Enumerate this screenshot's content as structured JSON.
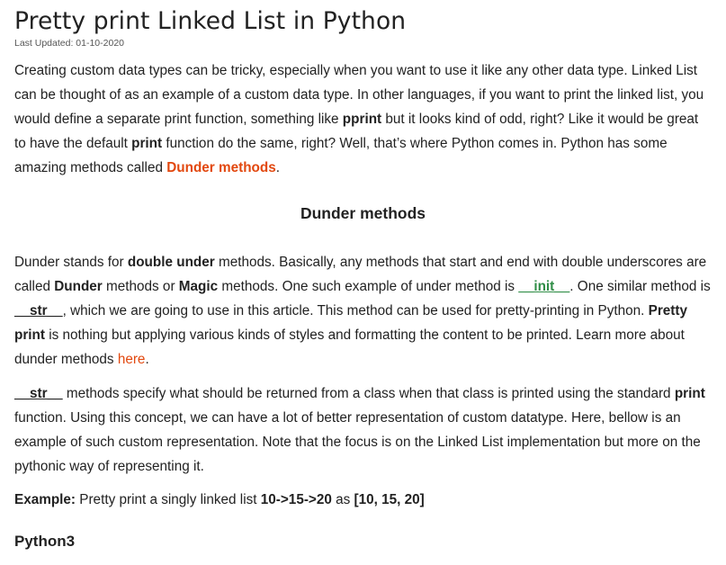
{
  "article": {
    "title": "Pretty print Linked List in Python",
    "last_updated": "Last Updated: 01-10-2020",
    "intro": {
      "t1": "Creating custom data types can be tricky, especially when you want to use it like any other data type. Linked List can be thought of as an example of a custom data type. In other languages, if you want to print the linked list, you would define a separate print function, something like ",
      "b1": "pprint",
      "t2": " but it looks kind of odd, right? Like it would be great to have the default ",
      "b2": "print",
      "t3": " function do the same, right? Well, that’s where Python comes in. Python has some amazing methods called ",
      "link": "Dunder methods",
      "t4": "."
    },
    "section_heading": "Dunder methods",
    "p2": {
      "t1": "Dunder stands for ",
      "b1": "double under",
      "t2": " methods. Basically, any methods that start and end with double underscores are called ",
      "b2": "Dunder",
      "t3": " methods or ",
      "b3": "Magic",
      "t4": " methods. One such example of under method is ",
      "code_init": "__init__",
      "t5": ". One similar method is ",
      "code_str": "__str__",
      "t6": ", which we are going to use in this article. This method can be used for pretty-printing in Python. ",
      "b4": "Pretty print",
      "t7": " is nothing but applying various kinds of styles and formatting the content to be printed. Learn more about dunder methods ",
      "link": "here",
      "t8": "."
    },
    "p3": {
      "code_str": "__str__",
      "t1": " methods specify what should be returned from a class when that class is printed using the standard ",
      "b1": "print",
      "t2": " function. Using this concept, we can have a lot of better representation of custom datatype. Here, bellow is an example of such custom representation. Note that the focus is on the Linked List implementation but more on the pythonic way of representing it."
    },
    "example": {
      "label": "Example:",
      "t1": " Pretty print a singly linked list ",
      "b1": "10->15->20",
      "t2": " as ",
      "b2": "[10, 15, 20]"
    },
    "code_heading": "Python3"
  }
}
